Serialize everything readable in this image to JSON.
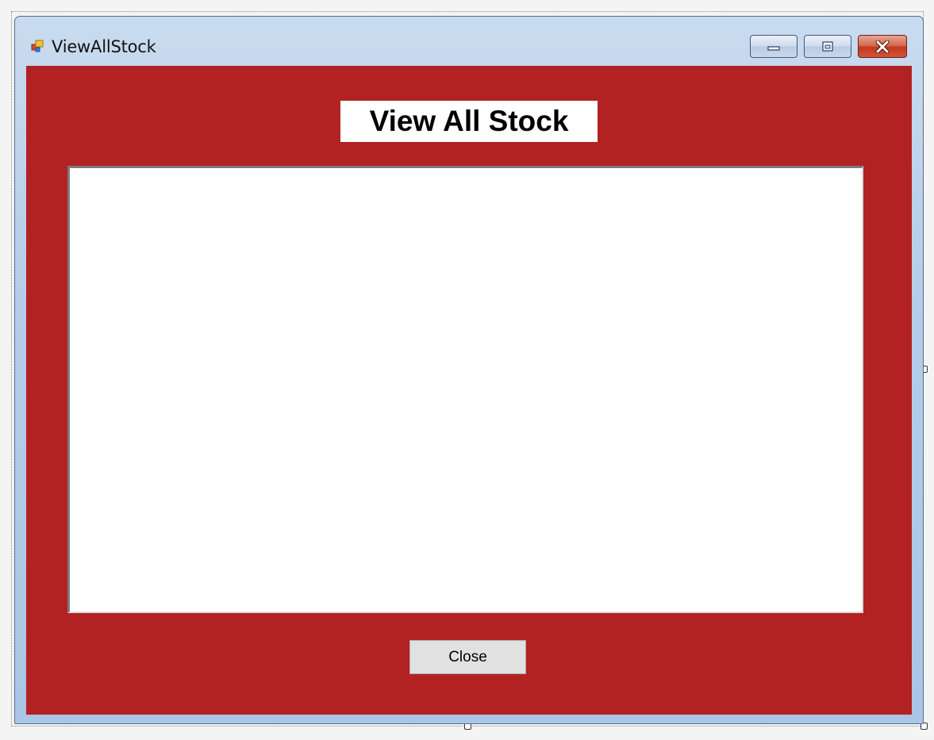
{
  "window": {
    "title": "ViewAllStock",
    "app_icon": "windows-form-icon",
    "controls": {
      "minimize_icon": "minimize-icon",
      "maximize_icon": "maximize-icon",
      "close_icon": "close-x-icon"
    }
  },
  "form": {
    "background_color": "#b22222",
    "heading": "View All Stock",
    "close_button_label": "Close"
  }
}
